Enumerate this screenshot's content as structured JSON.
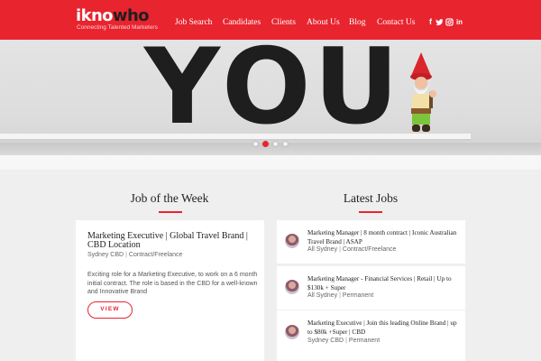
{
  "header": {
    "logo_main": "ikno",
    "logo_accent": "who",
    "tagline": "Connecting Talented Marketers",
    "nav": [
      "Job Search",
      "Candidates",
      "Clients",
      "About Us",
      "Blog",
      "Contact Us"
    ],
    "social_icons": [
      "facebook-icon",
      "twitter-icon",
      "instagram-icon",
      "linkedin-icon"
    ]
  },
  "hero": {
    "letters": [
      "Y",
      "O",
      "U"
    ],
    "slides_count": 4,
    "active_slide": 2
  },
  "colors": {
    "brand": "#e8242f",
    "dark": "#1f1f1f",
    "background": "#efefef"
  },
  "job_of_week": {
    "heading": "Job of the Week",
    "title": "Marketing Executive | Global Travel Brand | CBD Location",
    "location": "Sydney CBD",
    "type": "Contract/Freelance",
    "description": "Exciting role for a Marketing Executive, to work on a 6 month initial contract. The role is based in the CBD for a well-known and Innovative Brand",
    "button": "VIEW"
  },
  "latest_jobs": {
    "heading": "Latest Jobs",
    "items": [
      {
        "title": "Marketing Manager | 8 month contract | Iconic Australian Travel Brand | ASAP",
        "location": "All Sydney",
        "type": "Contract/Freelance"
      },
      {
        "title": "Marketing Manager - Financial Services | Retail | Up to $130k + Super",
        "location": "All Sydney",
        "type": "Permanent"
      },
      {
        "title": "Marketing Executive | Join this leading Online Brand | up to $80k +Super | CBD",
        "location": "Sydney CBD",
        "type": "Permanent"
      }
    ]
  }
}
